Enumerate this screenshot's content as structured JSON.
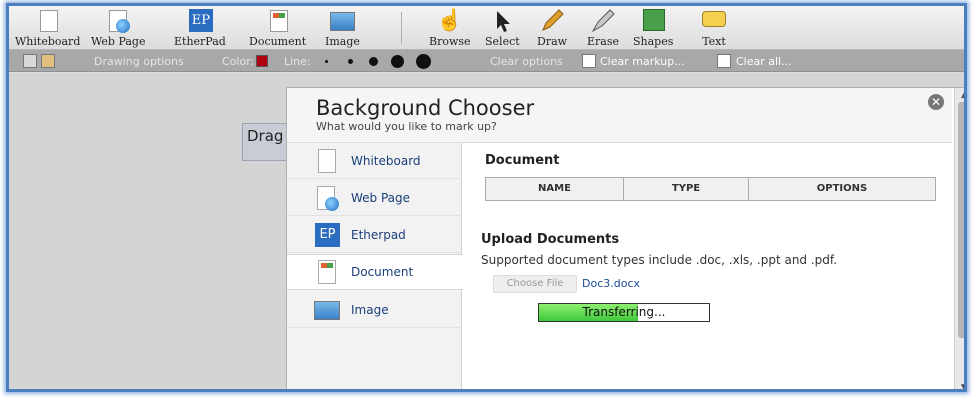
{
  "toolbar": {
    "tools": [
      {
        "id": "whiteboard",
        "label": "Whiteboard",
        "icon": "whiteboard-icon"
      },
      {
        "id": "webpage",
        "label": "Web Page",
        "icon": "web-page-icon"
      },
      {
        "id": "etherpad",
        "label": "EtherPad",
        "icon": "etherpad-icon"
      },
      {
        "id": "document",
        "label": "Document",
        "icon": "document-icon"
      },
      {
        "id": "image",
        "label": "Image",
        "icon": "image-icon"
      },
      {
        "id": "browse",
        "label": "Browse",
        "icon": "hand-icon"
      },
      {
        "id": "select",
        "label": "Select",
        "icon": "arrow-cursor-icon"
      },
      {
        "id": "draw",
        "label": "Draw",
        "icon": "pencil-icon"
      },
      {
        "id": "erase",
        "label": "Erase",
        "icon": "eraser-icon"
      },
      {
        "id": "shapes",
        "label": "Shapes",
        "icon": "shapes-icon"
      },
      {
        "id": "text",
        "label": "Text",
        "icon": "text-bubble-icon"
      }
    ],
    "etherpad_badge": "EP"
  },
  "subbar": {
    "drawing_options": "Drawing options",
    "color_label": "Color:",
    "line_label": "Line:",
    "clear_options": "Clear options",
    "clear_markup": "Clear markup...",
    "clear_all": "Clear all..."
  },
  "canvas": {
    "drag_label": "Drag"
  },
  "modal": {
    "title": "Background Chooser",
    "subtitle": "What would you like to mark up?",
    "sidebar": [
      {
        "label": "Whiteboard",
        "icon": "whiteboard-icon"
      },
      {
        "label": "Web Page",
        "icon": "web-page-icon"
      },
      {
        "label": "Etherpad",
        "icon": "etherpad-icon"
      },
      {
        "label": "Document",
        "icon": "document-icon",
        "active": true
      },
      {
        "label": "Image",
        "icon": "image-icon"
      }
    ],
    "etherpad_badge": "EP",
    "document_section": {
      "title": "Document",
      "columns": [
        "NAME",
        "TYPE",
        "OPTIONS"
      ]
    },
    "upload_section": {
      "title": "Upload Documents",
      "description": "Supported document types include .doc, .xls, .ppt and .pdf.",
      "choose_file": "Choose File",
      "file_name": "Doc3.docx",
      "progress_text": "Transferring...",
      "progress": 0.58
    }
  },
  "colors": {
    "accent_blue": "#4a7fc0",
    "progress_green": "#3fc83a",
    "color_swatch": "#b00010"
  }
}
